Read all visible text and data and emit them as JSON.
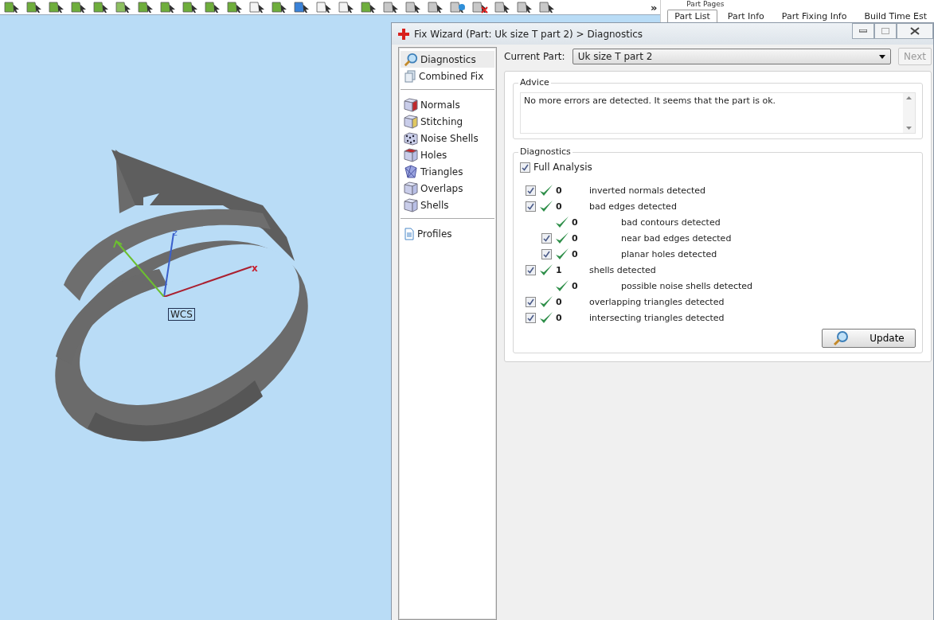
{
  "toolbar": {
    "overflow": "»"
  },
  "part_pages": {
    "title": "Part Pages",
    "tabs": [
      {
        "label": "Part List",
        "selected": true
      },
      {
        "label": "Part Info",
        "selected": false
      },
      {
        "label": "Part Fixing Info",
        "selected": false
      },
      {
        "label": "Build Time Est",
        "selected": false
      }
    ]
  },
  "viewport": {
    "axes": {
      "z": "z",
      "x": "x"
    },
    "label": "WCS"
  },
  "window": {
    "title": "Fix Wizard (Part: Uk size T part 2) > Diagnostics"
  },
  "sidebar": {
    "groups": [
      [
        {
          "label": "Diagnostics",
          "kind": "magnifier",
          "selected": true
        },
        {
          "label": "Combined Fix",
          "kind": "pages",
          "selected": false
        }
      ],
      [
        {
          "label": "Normals",
          "kind": "redside",
          "selected": false
        },
        {
          "label": "Stitching",
          "kind": "yellowside",
          "selected": false
        },
        {
          "label": "Noise Shells",
          "kind": "dice",
          "selected": false
        },
        {
          "label": "Holes",
          "kind": "redtop",
          "selected": false
        },
        {
          "label": "Triangles",
          "kind": "triangles",
          "selected": false
        },
        {
          "label": "Overlaps",
          "kind": "cube",
          "selected": false
        },
        {
          "label": "Shells",
          "kind": "cube",
          "selected": false
        }
      ],
      [
        {
          "label": "Profiles",
          "kind": "document",
          "selected": false
        }
      ]
    ]
  },
  "current_part": {
    "label": "Current Part:",
    "value": "Uk size T part 2",
    "next": {
      "label": "Next",
      "disabled": true
    }
  },
  "advice": {
    "title": "Advice",
    "text": "No more errors are detected. It seems that the part is ok."
  },
  "diagnostics": {
    "title": "Diagnostics",
    "full_analysis": {
      "label": "Full Analysis",
      "checked": true
    },
    "rows": [
      {
        "kind": "check",
        "checked": true,
        "count": "0",
        "label": "inverted normals detected"
      },
      {
        "kind": "check",
        "checked": true,
        "count": "0",
        "label": "bad edges detected",
        "children": [
          {
            "kind": "plain",
            "count": "0",
            "label": "bad contours detected"
          },
          {
            "kind": "check",
            "checked": true,
            "count": "0",
            "label": "near bad edges detected"
          },
          {
            "kind": "check",
            "checked": true,
            "count": "0",
            "label": "planar holes detected"
          }
        ]
      },
      {
        "kind": "check",
        "checked": true,
        "count": "1",
        "label": "shells detected",
        "children": [
          {
            "kind": "plain",
            "count": "0",
            "label": "possible noise shells detected"
          }
        ]
      },
      {
        "kind": "check",
        "checked": true,
        "count": "0",
        "label": "overlapping triangles detected"
      },
      {
        "kind": "check",
        "checked": true,
        "count": "0",
        "label": "intersecting triangles detected"
      }
    ],
    "update": "Update"
  }
}
